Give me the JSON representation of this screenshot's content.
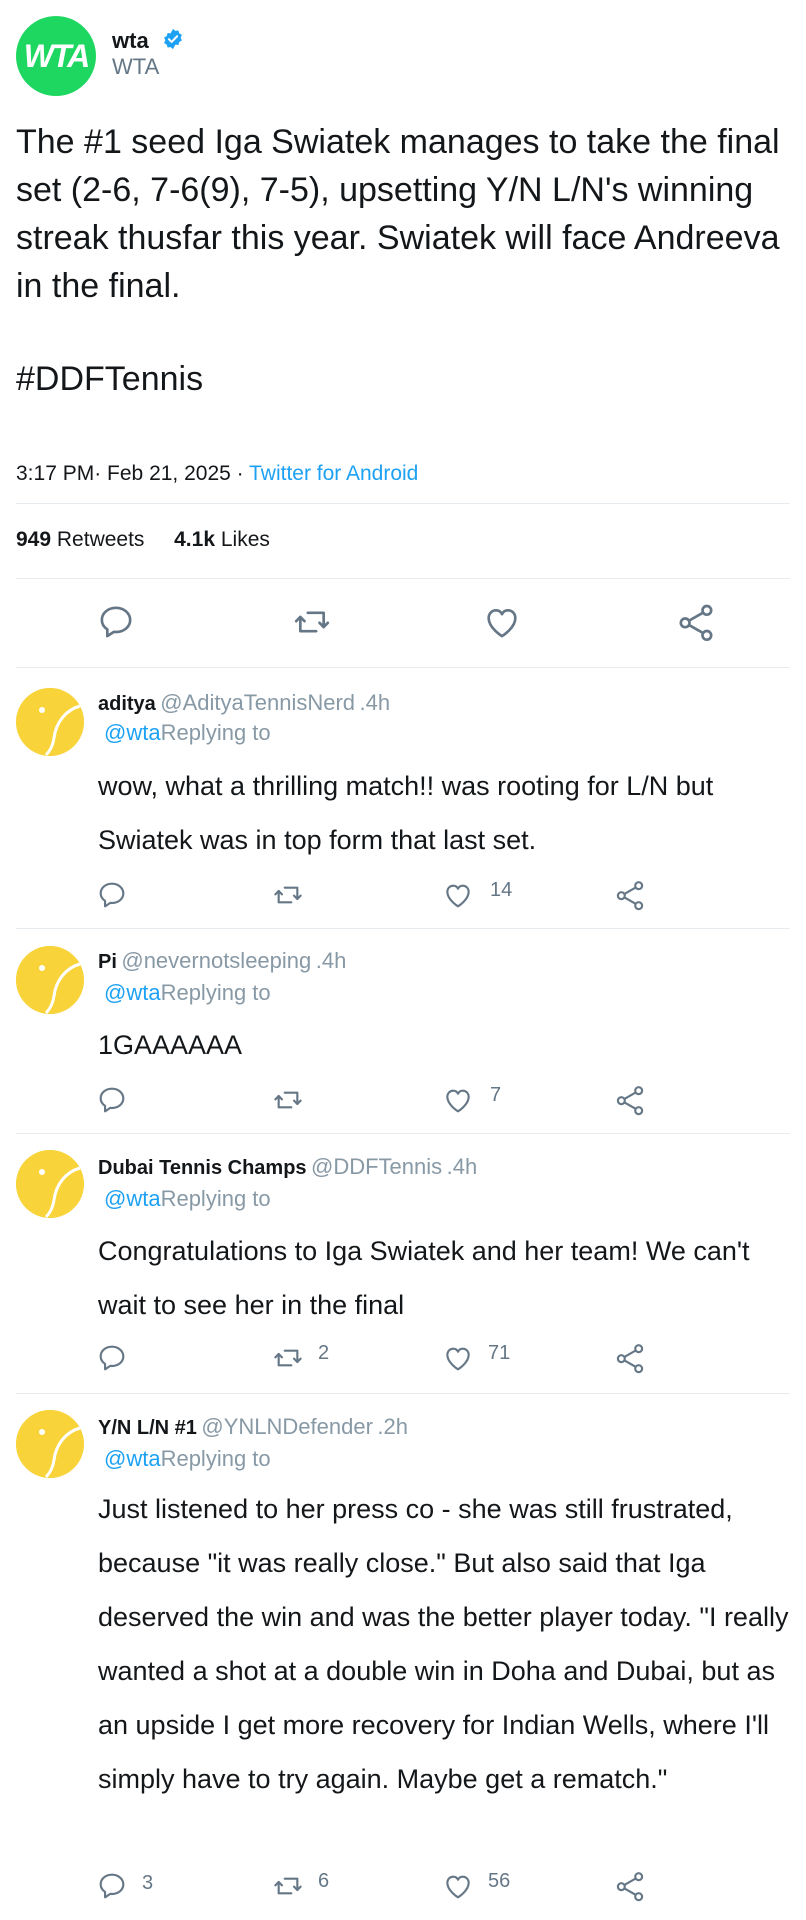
{
  "tweet": {
    "avatar_text": "WTA",
    "display_name": "wta",
    "handle": "WTA",
    "text": "The #1 seed Iga Swiatek manages to take the final set (2-6, 7-6(9), 7-5), upsetting Y/N L/N's winning streak thusfar this year. Swiatek will face Andreeva in the final.",
    "hashtag": "#DDFTennis",
    "time": "3:17 PM",
    "date": "· Feb 21, 2025",
    "source_sep": " · ",
    "source": "Twitter for Android",
    "retweets_count": "949",
    "retweets_label": "Retweets",
    "likes_count": "4.1k",
    "likes_label": "Likes"
  },
  "replies": [
    {
      "name": "aditya",
      "handle": "@AdityaTennisNerd",
      "time": ".4h",
      "replying_at": "@wta",
      "replying_label": "Replying to",
      "text": "wow, what a thrilling match!! was rooting for L/N but Swiatek was in top form that last set.",
      "reply_count": "",
      "retweet_count": "",
      "like_count": "14"
    },
    {
      "name": "Pi",
      "handle": "@nevernotsleeping",
      "time": ".4h",
      "replying_at": "@wta",
      "replying_label": "Replying to",
      "text": "1GAAAAAA",
      "reply_count": "",
      "retweet_count": "",
      "like_count": "7"
    },
    {
      "name": "Dubai Tennis Champs",
      "handle": "@DDFTennis",
      "time": ".4h",
      "replying_at": "@wta",
      "replying_label": "Replying to",
      "text": "Congratulations to Iga Swiatek and her team! We can't wait to see her in the final",
      "reply_count": "",
      "retweet_count": "2",
      "like_count": "71"
    },
    {
      "name": "Y/N L/N #1",
      "handle": "@YNLNDefender",
      "time": ".2h",
      "replying_at": "@wta",
      "replying_label": "Replying to",
      "text": "Just listened to her press co - she was still frustrated, because \"it was really close.\" But also said that Iga deserved the win and was the better player today. \"I really wanted a shot at a double win in Doha and Dubai, but as an upside I get more recovery for Indian Wells, where I'll simply have to try again. Maybe get a rematch.\"",
      "reply_count": "3",
      "retweet_count": "6",
      "like_count": "56"
    }
  ],
  "icons": {
    "verified": "verified-badge-icon",
    "reply": "reply-icon",
    "retweet": "retweet-icon",
    "like": "heart-icon",
    "share": "share-icon",
    "avatar": "tennis-ball-icon"
  },
  "colors": {
    "wta_green": "#1ed760",
    "verified_blue": "#1da1f2",
    "link_blue": "#1da1f2",
    "tennis_yellow": "#f8d33a",
    "muted": "#8899a6"
  }
}
